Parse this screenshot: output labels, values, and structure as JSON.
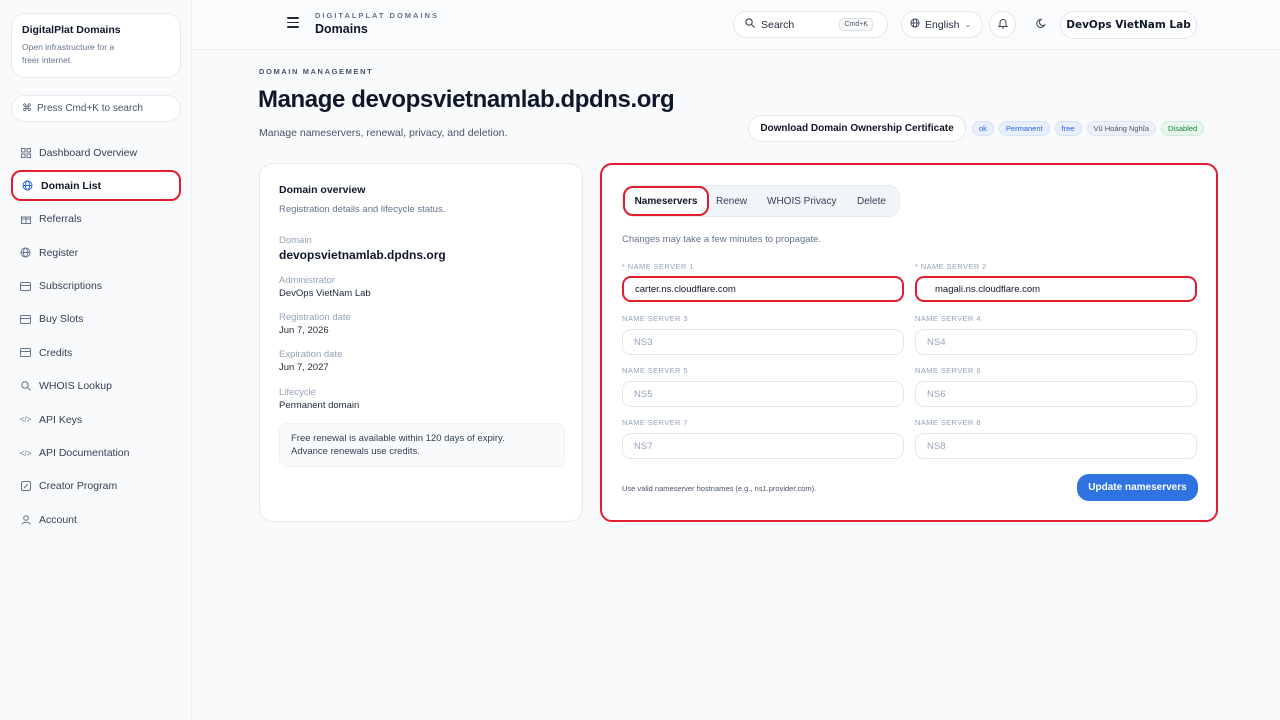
{
  "brand": {
    "title": "DigitalPlat Domains",
    "subtitle": "Open infrastructure for a freer internet"
  },
  "sidebar": {
    "search_hint": "Press Cmd+K to search",
    "items": [
      {
        "label": "Dashboard Overview",
        "icon": "grid-icon"
      },
      {
        "label": "Domain List",
        "icon": "globe-icon",
        "active": true
      },
      {
        "label": "Referrals",
        "icon": "gift-icon"
      },
      {
        "label": "Register",
        "icon": "globe-icon"
      },
      {
        "label": "Subscriptions",
        "icon": "card-icon"
      },
      {
        "label": "Buy Slots",
        "icon": "card-icon"
      },
      {
        "label": "Credits",
        "icon": "card-icon"
      },
      {
        "label": "WHOIS Lookup",
        "icon": "search-icon"
      },
      {
        "label": "API Keys",
        "icon": "code-icon"
      },
      {
        "label": "API Documentation",
        "icon": "code-icon"
      },
      {
        "label": "Creator Program",
        "icon": "edit-icon"
      },
      {
        "label": "Account",
        "icon": "user-icon"
      }
    ]
  },
  "topbar": {
    "kicker": "DIGITALPLAT DOMAINS",
    "title": "Domains",
    "search_label": "Search",
    "search_shortcut": "Cmd+K",
    "language": "English",
    "user": "DevOps VietNam Lab"
  },
  "header": {
    "kicker": "DOMAIN MANAGEMENT",
    "title": "Manage devopsvietnamlab.dpdns.org",
    "subtitle": "Manage nameservers, renewal, privacy, and deletion.",
    "certificate_button": "Download Domain Ownership Certificate",
    "badges": [
      "ok",
      "Permanent",
      "free",
      "Vũ Hoàng Nghĩa",
      "Disabled"
    ]
  },
  "overview": {
    "title": "Domain overview",
    "subtitle": "Registration details and lifecycle status.",
    "domain_label": "Domain",
    "domain_value": "devopsvietnamlab.dpdns.org",
    "admin_label": "Administrator",
    "admin_value": "DevOps VietNam Lab",
    "reg_label": "Registration date",
    "reg_value": "Jun 7, 2026",
    "exp_label": "Expiration date",
    "exp_value": "Jun 7, 2027",
    "life_label": "Lifecycle",
    "life_value": "Permanent domain",
    "note_line1": "Free renewal is available within 120 days of expiry.",
    "note_line2": "Advance renewals use credits."
  },
  "panel": {
    "tabs": [
      "Nameservers",
      "Renew",
      "WHOIS Privacy",
      "Delete"
    ],
    "active_tab": "Nameservers",
    "propagate_note": "Changes may take a few minutes to propagate.",
    "nameservers": [
      {
        "label": "* NAME SERVER 1",
        "value": "carter.ns.cloudflare.com",
        "placeholder": ""
      },
      {
        "label": "* NAME SERVER 2",
        "value": "magali.ns.cloudflare.com",
        "placeholder": ""
      },
      {
        "label": "NAME SERVER 3",
        "value": "",
        "placeholder": "NS3"
      },
      {
        "label": "NAME SERVER 4",
        "value": "",
        "placeholder": "NS4"
      },
      {
        "label": "NAME SERVER 5",
        "value": "",
        "placeholder": "NS5"
      },
      {
        "label": "NAME SERVER 6",
        "value": "",
        "placeholder": "NS6"
      },
      {
        "label": "NAME SERVER 7",
        "value": "",
        "placeholder": "NS7"
      },
      {
        "label": "NAME SERVER 8",
        "value": "",
        "placeholder": "NS8"
      }
    ],
    "hint": "Use valid nameserver hostnames (e.g., ns1.provider.com).",
    "update_button": "Update nameservers"
  },
  "colors": {
    "accent": "#2f73e0",
    "highlight": "#e11d2e"
  }
}
